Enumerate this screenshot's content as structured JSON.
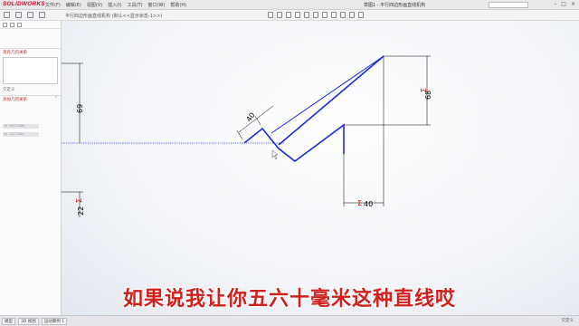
{
  "app": {
    "logo_text": "SOLIDWORKS"
  },
  "menu": {
    "items": [
      "文件(F)",
      "编辑(E)",
      "视图(V)",
      "插入(I)",
      "工具(T)",
      "窗口(W)",
      "帮助(H)"
    ]
  },
  "window": {
    "title": "草图1 - 平行四边形画直线机构",
    "search_placeholder": ""
  },
  "command_bar": {
    "breadcrumb": "平行四边形画直线机构 (默认<<显示状态-1>>)"
  },
  "left_panel": {
    "section_title": "现有几何关系",
    "status_text": "欠定义",
    "add_relations_title": "添加几何关系",
    "field_1": "15.16971800",
    "field_2": "45.72773601"
  },
  "sketch": {
    "dims": {
      "d40_top": "40",
      "d69": "69",
      "d68": "68",
      "d40_bottom": "40",
      "d22": "22"
    }
  },
  "bottom_tabs": [
    "模型",
    "3D 视图",
    "运动算例 1"
  ],
  "status_text": "欠定义",
  "subtitle": "如果说我让你五六十毫米这种直线哎",
  "colors": {
    "sketch_line": "#1a2bd8",
    "dim_text": "#000000",
    "sigma": "#d11010",
    "subtitle": "#d0201c"
  }
}
